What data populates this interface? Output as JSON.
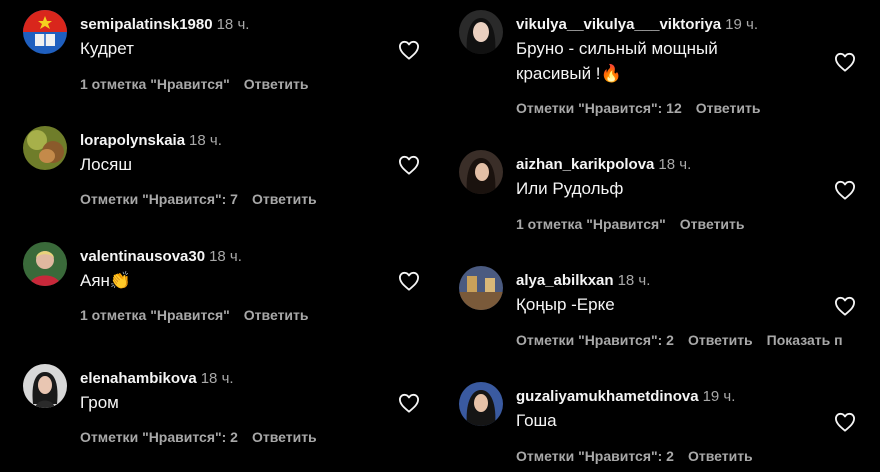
{
  "comments_left": [
    {
      "username": "semipalatinsk1980",
      "time": "18 ч.",
      "text": "Кудрет",
      "likes": "1 отметка \"Нравится\"",
      "reply": "Ответить"
    },
    {
      "username": "lorapolynskaia",
      "time": "18 ч.",
      "text": "Лосяш",
      "likes": "Отметки \"Нравится\": 7",
      "reply": "Ответить"
    },
    {
      "username": "valentinausova30",
      "time": "18 ч.",
      "text": "Аян👏",
      "likes": "1 отметка \"Нравится\"",
      "reply": "Ответить"
    },
    {
      "username": "elenahambikova",
      "time": "18 ч.",
      "text": "Гром",
      "likes": "Отметки \"Нравится\": 2",
      "reply": "Ответить"
    }
  ],
  "comments_right": [
    {
      "username": "vikulya__vikulya___viktoriya",
      "time": "19 ч.",
      "text_line1": "Бруно - сильный мощный",
      "text_line2": "красивый !🔥",
      "likes": "Отметки \"Нравится\": 12",
      "reply": "Ответить"
    },
    {
      "username": "aizhan_karikpolova",
      "time": "18 ч.",
      "text": "Или Рудольф",
      "likes": "1 отметка \"Нравится\"",
      "reply": "Ответить"
    },
    {
      "username": "alya_abilkxan",
      "time": "18 ч.",
      "text": "Қоңыр -Ерке",
      "likes": "Отметки \"Нравится\": 2",
      "reply": "Ответить",
      "show_translation": "Показать п"
    },
    {
      "username": "guzaliyamukhametdinova",
      "time": "19 ч.",
      "text": "Гоша",
      "likes": "Отметки \"Нравится\": 2",
      "reply": "Ответить"
    }
  ],
  "icons": {
    "heart": "heart-outline-icon"
  },
  "colors": {
    "background": "#000000",
    "primary_text": "#f5f5f5",
    "secondary_text": "#a8a8a8"
  }
}
